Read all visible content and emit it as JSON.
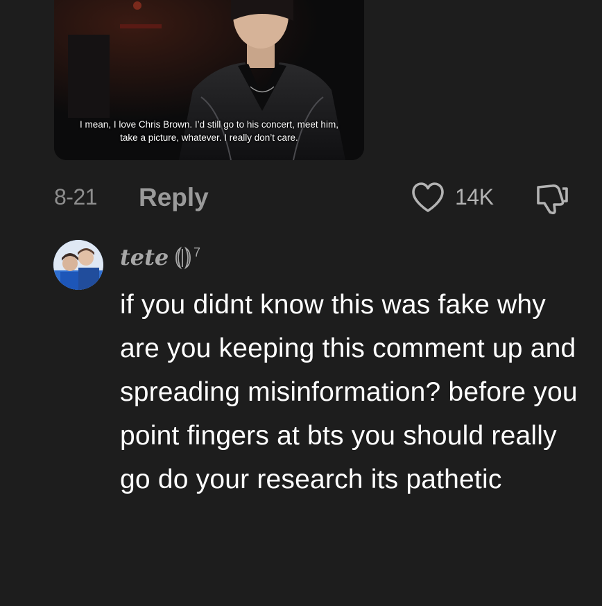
{
  "media": {
    "subtitle_line1": "I mean, I love Chris Brown. I’d still go to his concert, meet him,",
    "subtitle_line2": "take a picture, whatever. I really don’t care."
  },
  "actions": {
    "date": "8-21",
    "reply_label": "Reply",
    "like_count": "14K",
    "like_icon": "heart-outline-icon",
    "dislike_icon": "thumbs-down-outline-icon"
  },
  "reply_comment": {
    "username": "tete",
    "badge_icon": "moon-seven-glyph-icon",
    "badge_text": "7",
    "text": "if you didnt know this was fake why are you keeping this comment up and spreading misinformation? before you point fingers at bts you should really go do your research its pathetic"
  },
  "colors": {
    "background": "#1d1d1d",
    "muted_text": "#8e8e8e",
    "primary_text": "#ffffff"
  }
}
